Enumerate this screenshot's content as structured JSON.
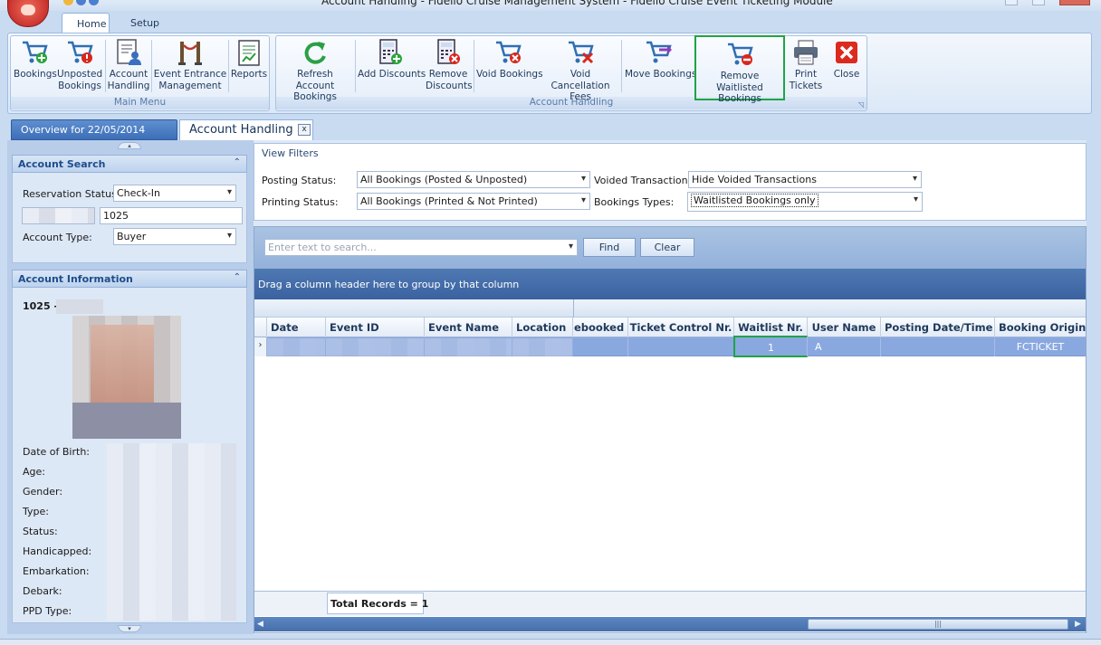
{
  "window": {
    "title": "Account Handling - Fidelio Cruise Management System - Fidelio Cruise Event Ticketing Module"
  },
  "ribbon": {
    "tabs": [
      {
        "label": "Home"
      },
      {
        "label": "Setup"
      }
    ],
    "main_menu": {
      "caption": "Main Menu",
      "buttons": [
        {
          "label": "Bookings",
          "icon": "cart-add-icon"
        },
        {
          "label": "Unposted Bookings",
          "icon": "cart-alert-icon"
        },
        {
          "label": "Account Handling",
          "icon": "account-handling-icon"
        },
        {
          "label": "Event Entrance Management",
          "icon": "entrance-rope-icon"
        },
        {
          "label": "Reports",
          "icon": "report-icon"
        }
      ]
    },
    "account_handling": {
      "caption": "Account Handling",
      "buttons": [
        {
          "label": "Refresh Account Bookings",
          "icon": "refresh-icon"
        },
        {
          "label": "Add Discounts",
          "icon": "calculator-add-icon"
        },
        {
          "label": "Remove Discounts",
          "icon": "calculator-remove-icon"
        },
        {
          "label": "Void Bookings",
          "icon": "cart-void-icon"
        },
        {
          "label": "Void Cancellation Fees",
          "icon": "cart-cancel-icon"
        },
        {
          "label": "Move Bookings",
          "icon": "cart-move-icon"
        },
        {
          "label": "Remove Waitlisted Bookings",
          "icon": "cart-remove-icon"
        },
        {
          "label": "Print Tickets",
          "icon": "printer-icon"
        },
        {
          "label": "Close",
          "icon": "close-icon"
        }
      ]
    }
  },
  "doc_tabs": {
    "overview": "Overview for 22/05/2014",
    "account": "Account Handling",
    "close_glyph": "x"
  },
  "account_search": {
    "header": "Account Search",
    "reservation_status_label": "Reservation Status:",
    "reservation_status_value": "Check-In",
    "account_number": "1025",
    "account_type_label": "Account Type:",
    "account_type_value": "Buyer"
  },
  "account_info": {
    "header": "Account Information",
    "name": "1025 -",
    "fields": [
      {
        "label": "Date of Birth:"
      },
      {
        "label": "Age:"
      },
      {
        "label": "Gender:"
      },
      {
        "label": "Type:"
      },
      {
        "label": "Status:"
      },
      {
        "label": "Handicapped:"
      },
      {
        "label": "Embarkation:"
      },
      {
        "label": "Debark:"
      },
      {
        "label": "PPD Type:"
      }
    ]
  },
  "view_filters": {
    "title": "View Filters",
    "posting_status_label": "Posting Status:",
    "posting_status_value": "All Bookings (Posted & Unposted)",
    "printing_status_label": "Printing Status:",
    "printing_status_value": "All Bookings (Printed & Not Printed)",
    "voided_label": "Voided Transactions:",
    "voided_value": "Hide Voided Transactions",
    "bookings_types_label": "Bookings Types:",
    "bookings_types_value": "Waitlisted Bookings only"
  },
  "grid": {
    "search_placeholder": "Enter text to search...",
    "find_label": "Find",
    "clear_label": "Clear",
    "group_hint": "Drag a column header here to group by that column",
    "columns": [
      "Date",
      "Event ID",
      "Event Name",
      "Location",
      "ebooked",
      "Ticket Control Nr.",
      "Waitlist Nr.",
      "User Name",
      "Posting Date/Time",
      "Booking Origin"
    ],
    "rows": [
      {
        "date": "",
        "event_id": "",
        "event_name": "",
        "location": "",
        "rebooked": "",
        "ticket_control": "",
        "waitlist_nr": "1",
        "user_name": "A",
        "posting": "",
        "origin": "FCTICKET"
      }
    ],
    "total_records": "Total Records = 1"
  },
  "colors": {
    "highlight": "#1ea446",
    "accent": "#3d6fb8",
    "selected_row": "#8aa8e0"
  }
}
